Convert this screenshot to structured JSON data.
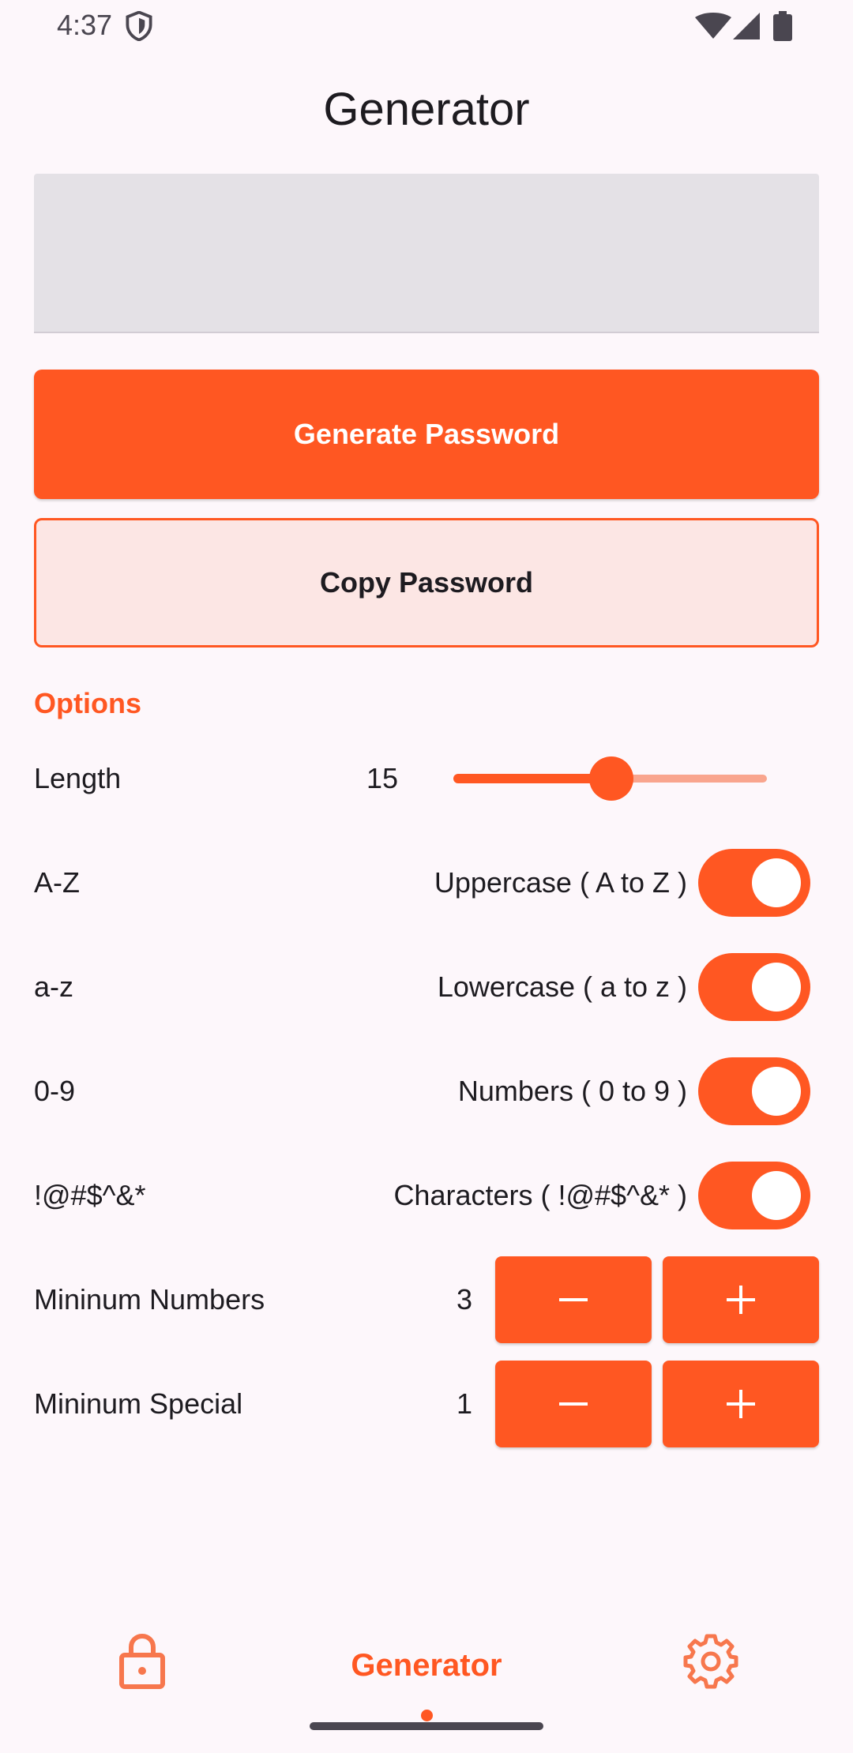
{
  "status_bar": {
    "time": "4:37",
    "icons": [
      "shield-icon",
      "wifi-icon",
      "signal-icon",
      "battery-icon"
    ]
  },
  "title": "Generator",
  "password_output": {
    "value": ""
  },
  "buttons": {
    "generate": "Generate Password",
    "copy": "Copy Password"
  },
  "options": {
    "heading": "Options",
    "length": {
      "label": "Length",
      "value": "15",
      "slider_fraction": 0.5
    },
    "toggles": [
      {
        "label": "A-Z",
        "description": "Uppercase ( A to Z )",
        "on": true
      },
      {
        "label": "a-z",
        "description": "Lowercase ( a to z )",
        "on": true
      },
      {
        "label": "0-9",
        "description": "Numbers ( 0 to 9 )",
        "on": true
      },
      {
        "label": "!@#$^&*",
        "description": "Characters ( !@#$^&* )",
        "on": true
      }
    ],
    "min_numbers": {
      "label": "Mininum Numbers",
      "value": "3"
    },
    "min_special": {
      "label": "Mininum Special",
      "value": "1"
    }
  },
  "bottom_nav": {
    "items": [
      {
        "icon": "lock-icon",
        "label": ""
      },
      {
        "icon": "",
        "label": "Generator",
        "active": true
      },
      {
        "icon": "gear-icon",
        "label": ""
      }
    ]
  },
  "colors": {
    "accent": "#ff5722",
    "background": "#fdf7fb",
    "output_box": "#e4e1e6",
    "copy_button_bg": "#fce6e4",
    "slider_inactive": "#f9a58e"
  }
}
